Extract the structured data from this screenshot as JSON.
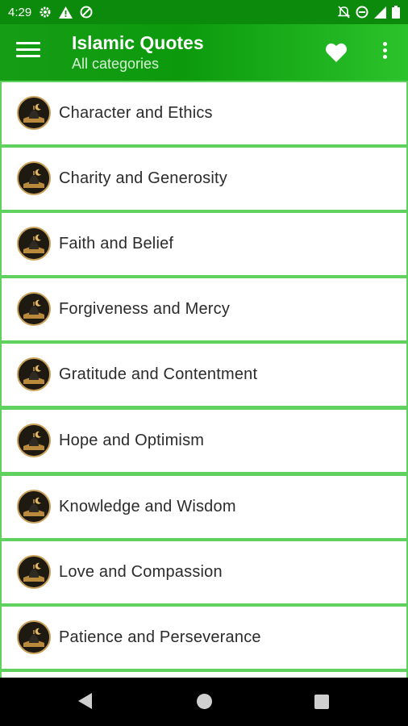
{
  "status_bar": {
    "time": "4:29",
    "left_icons": [
      "gear-icon",
      "warning-icon",
      "do-not-disturb-icon"
    ],
    "right_icons": [
      "mute-icon",
      "dnd-icon",
      "signal-icon",
      "battery-icon"
    ]
  },
  "app_bar": {
    "title": "Islamic Quotes",
    "subtitle": "All categories",
    "icons": [
      "menu-icon",
      "heart-icon",
      "more-vert-icon"
    ]
  },
  "categories": [
    {
      "label": "Character and Ethics"
    },
    {
      "label": "Charity and Generosity"
    },
    {
      "label": "Faith and Belief"
    },
    {
      "label": "Forgiveness and Mercy"
    },
    {
      "label": "Gratitude and Contentment"
    },
    {
      "label": "Hope and Optimism"
    },
    {
      "label": "Knowledge and Wisdom"
    },
    {
      "label": "Love and Compassion"
    },
    {
      "label": "Patience and Perseverance"
    }
  ],
  "colors": {
    "status_bar": "#0c8a0c",
    "app_bar_start": "#169d16",
    "app_bar_end": "#2bc32b",
    "list_divider": "#5ed15e",
    "item_background": "#ffffff",
    "text": "#2b2b2b"
  },
  "nav_bar": {
    "icons": [
      "back-icon",
      "home-icon",
      "recents-icon"
    ]
  }
}
